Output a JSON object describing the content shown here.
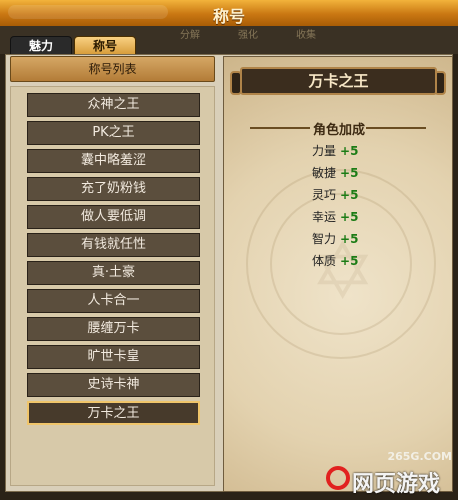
{
  "window": {
    "title": "称号"
  },
  "tabs": {
    "active": "称号",
    "inactive": "魅力",
    "ghost": [
      "分解",
      "强化",
      "收集"
    ]
  },
  "list": {
    "header": "称号列表",
    "items": [
      "众神之王",
      "PK之王",
      "囊中略羞涩",
      "充了奶粉钱",
      "做人要低调",
      "有钱就任性",
      "真·土豪",
      "人卡合一",
      "腰缠万卡",
      "旷世卡皇",
      "史诗卡神",
      "万卡之王"
    ],
    "selected_index": 11
  },
  "details": {
    "title": "万卡之王",
    "section_title": "角色加成",
    "stats": [
      {
        "name": "力量",
        "value": "+5"
      },
      {
        "name": "敏捷",
        "value": "+5"
      },
      {
        "name": "灵巧",
        "value": "+5"
      },
      {
        "name": "幸运",
        "value": "+5"
      },
      {
        "name": "智力",
        "value": "+5"
      },
      {
        "name": "体质",
        "value": "+5"
      }
    ]
  },
  "watermark": {
    "site": "265G.COM",
    "brand": "网页游戏"
  }
}
